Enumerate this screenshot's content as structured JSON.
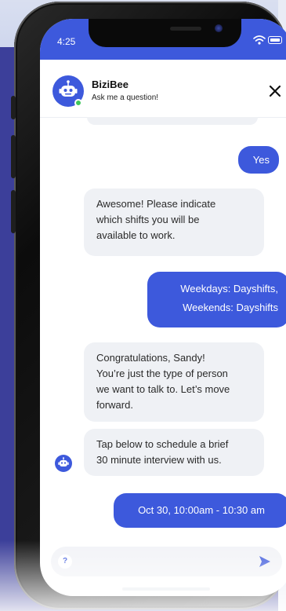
{
  "status_bar": {
    "time": "4:25"
  },
  "header": {
    "bot_name": "BiziBee",
    "subtitle": "Ask me a question!"
  },
  "messages": [
    {
      "sender": "user",
      "lines": [
        "Yes"
      ]
    },
    {
      "sender": "bot",
      "lines": [
        "Awesome! Please indicate",
        "which shifts you will be",
        "available to work."
      ]
    },
    {
      "sender": "user",
      "lines": [
        "Weekdays: Dayshifts,",
        "Weekends: Dayshifts"
      ]
    },
    {
      "sender": "bot",
      "lines": [
        "Congratulations, Sandy!",
        "You’re just the type of person",
        "we want to talk to. Let’s move",
        "forward."
      ]
    },
    {
      "sender": "bot",
      "lines": [
        "Tap below to schedule a brief",
        "30 minute interview with us."
      ]
    },
    {
      "sender": "user",
      "lines": [
        "Oct 30, 10:00am - 10:30 am"
      ]
    }
  ],
  "input": {
    "help_label": "?"
  },
  "colors": {
    "accent": "#3d59dc",
    "bot_bubble": "#eff1f5",
    "online": "#3fc65b"
  },
  "icons": {
    "close": "close-icon",
    "send": "send-icon",
    "wifi": "wifi-icon",
    "battery": "battery-icon",
    "bot": "robot-icon"
  }
}
